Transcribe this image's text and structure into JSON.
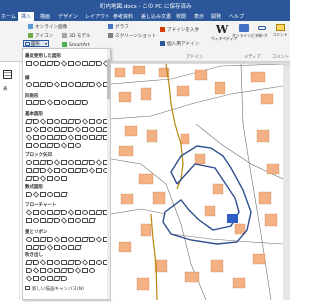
{
  "window": {
    "title": "町内地図.docx - この PC に保存済み"
  },
  "tabs": [
    {
      "label": "ホーム"
    },
    {
      "label": "挿入"
    },
    {
      "label": "描画"
    },
    {
      "label": "デザイン"
    },
    {
      "label": "レイアウト"
    },
    {
      "label": "参考資料"
    },
    {
      "label": "差し込み文書"
    },
    {
      "label": "校閲"
    },
    {
      "label": "表示"
    },
    {
      "label": "開発"
    },
    {
      "label": "ヘルプ"
    }
  ],
  "ribbon": {
    "shapes_button": "図形",
    "online_images": "オンライン画像",
    "icons": "アイコン",
    "models_3d": "3D モデル",
    "smartart": "SmartArt",
    "chart": "グラフ",
    "screenshot": "スクリーンショット",
    "get_addins": "アドインを入手",
    "my_addins": "個人用アドイン",
    "wikipedia": "ウィキペディア",
    "online_video": "オンラインビデオ",
    "link": "リンク",
    "comment": "コメント",
    "groups": {
      "addins": "アドイン",
      "media": "メディア",
      "comments": "コメント"
    }
  },
  "left": {
    "table_label": "表"
  },
  "gallery": {
    "sections": [
      "最近使用した図形",
      "線",
      "四角形",
      "基本図形",
      "ブロック矢印",
      "数式図形",
      "フローチャート",
      "星とリボン",
      "吹き出し"
    ],
    "new_canvas": "新しい描画キャンバス(N)"
  },
  "colors": {
    "accent": "#2b579a",
    "house": "#f4b183",
    "road_outline": "#2f4f8f",
    "highlight_lot": "#2f5fc4",
    "path": "#b8860b"
  }
}
